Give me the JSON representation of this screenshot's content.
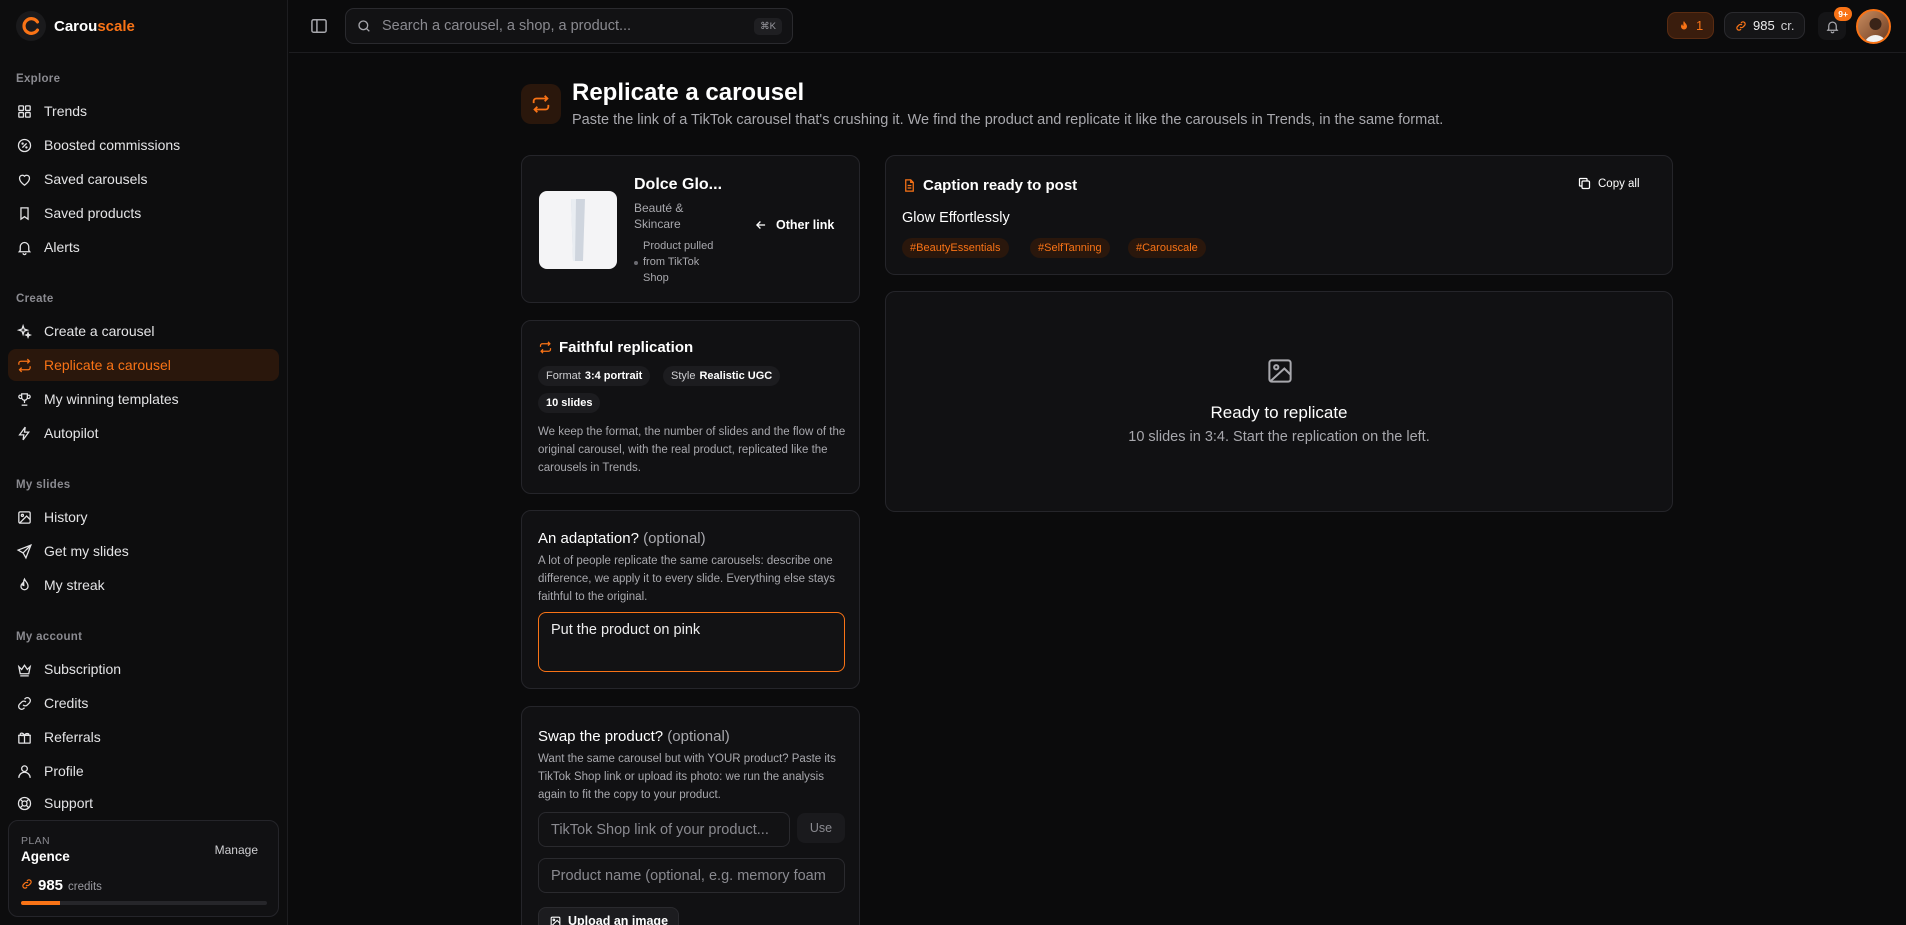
{
  "brand": {
    "name_part1": "Carou",
    "name_part2": "scale"
  },
  "search": {
    "placeholder": "Search a carousel, a shop, a product...",
    "shortcut": "⌘K"
  },
  "topbar": {
    "streak": "1",
    "credits": "985",
    "credits_unit": "cr.",
    "notifications_badge": "9+"
  },
  "sidebar": {
    "sections": {
      "explore": "Explore",
      "create": "Create",
      "my_slides": "My slides",
      "my_account": "My account"
    },
    "items": {
      "trends": "Trends",
      "boosted_commissions": "Boosted commissions",
      "saved_carousels": "Saved carousels",
      "saved_products": "Saved products",
      "alerts": "Alerts",
      "create_carousel": "Create a carousel",
      "replicate_carousel": "Replicate a carousel",
      "winning_templates": "My winning templates",
      "autopilot": "Autopilot",
      "history": "History",
      "get_slides": "Get my slides",
      "streak": "My streak",
      "subscription": "Subscription",
      "credits": "Credits",
      "referrals": "Referrals",
      "profile": "Profile",
      "support": "Support"
    },
    "plan": {
      "label": "PLAN",
      "name": "Agence",
      "manage": "Manage",
      "credits": "985",
      "credits_unit": "credits",
      "usage_fraction": 0.16
    }
  },
  "page": {
    "title": "Replicate a carousel",
    "subtitle": "Paste the link of a TikTok carousel that's crushing it. We find the product and replicate it like the carousels in Trends, in the same format."
  },
  "product": {
    "name": "Dolce Glo...",
    "category": "Beauté & Skincare",
    "source": "Product pulled from TikTok Shop",
    "other_link": "Other link"
  },
  "replication": {
    "title": "Faithful replication",
    "format_key": "Format",
    "format_value": "3:4 portrait",
    "style_key": "Style",
    "style_value": "Realistic UGC",
    "slides": "10 slides",
    "description": "We keep the format, the number of slides and the flow of the original carousel, with the real product, replicated like the carousels in Trends."
  },
  "adaptation": {
    "title": "An adaptation?",
    "optional": "(optional)",
    "description": "A lot of people replicate the same carousels: describe one difference, we apply it to every slide. Everything else stays faithful to the original.",
    "value": "Put the product on pink"
  },
  "swap": {
    "title": "Swap the product?",
    "optional": "(optional)",
    "description": "Want the same carousel but with YOUR product? Paste its TikTok Shop link or upload its photo: we run the analysis again to fit the copy to your product.",
    "link_placeholder": "TikTok Shop link of your product...",
    "use_label": "Use",
    "name_placeholder": "Product name (optional, e.g. memory foam",
    "upload_label": "Upload an image"
  },
  "caption": {
    "title": "Caption ready to post",
    "copy_all": "Copy all",
    "text": "Glow Effortlessly",
    "hashtags": [
      "#BeautyEssentials",
      "#SelfTanning",
      "#Carouscale"
    ]
  },
  "ready": {
    "title": "Ready to replicate",
    "subtitle": "10 slides in 3:4. Start the replication on the left."
  },
  "colors": {
    "accent": "#f97316",
    "background": "#0b0b0c",
    "card": "#111113"
  }
}
